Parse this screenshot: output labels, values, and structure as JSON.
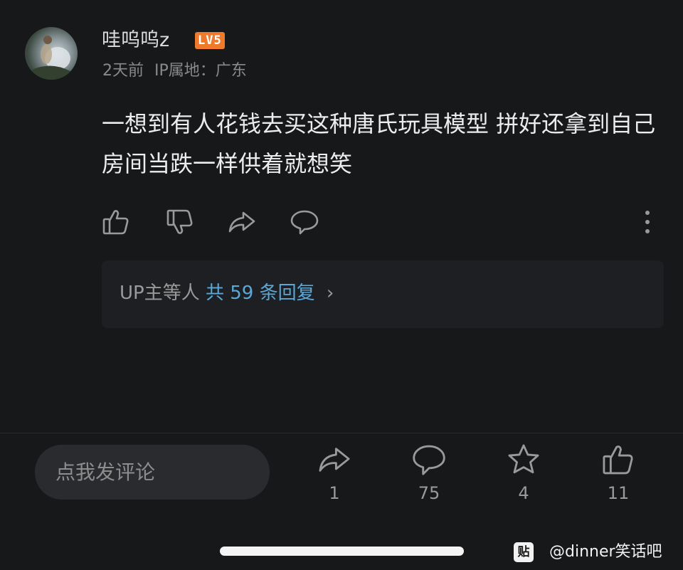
{
  "comment": {
    "username": "哇呜呜z",
    "level_badge": "LV5",
    "time": "2天前",
    "ip_location": "IP属地：广东",
    "text": "一想到有人花钱去买这种唐氏玩具模型 拼好还拿到自己房间当跌一样供着就想笑",
    "icons": [
      "thumbs-up-icon",
      "thumbs-down-icon",
      "share-icon",
      "comment-bubble-icon",
      "more-vertical-icon"
    ]
  },
  "replies": {
    "prefix": "UP主等人",
    "link": "共 59 条回复",
    "chevron": "›"
  },
  "bottom_bar": {
    "comment_placeholder": "点我发评论",
    "share_count": "1",
    "comment_count": "75",
    "favorite_count": "4",
    "like_count": "11"
  },
  "watermark": {
    "icon_glyph": "贴",
    "text": "@dinner笑话吧"
  },
  "colors": {
    "background": "#17181a",
    "level_badge": "#f07a2c",
    "reply_link": "#5aa8d8"
  }
}
